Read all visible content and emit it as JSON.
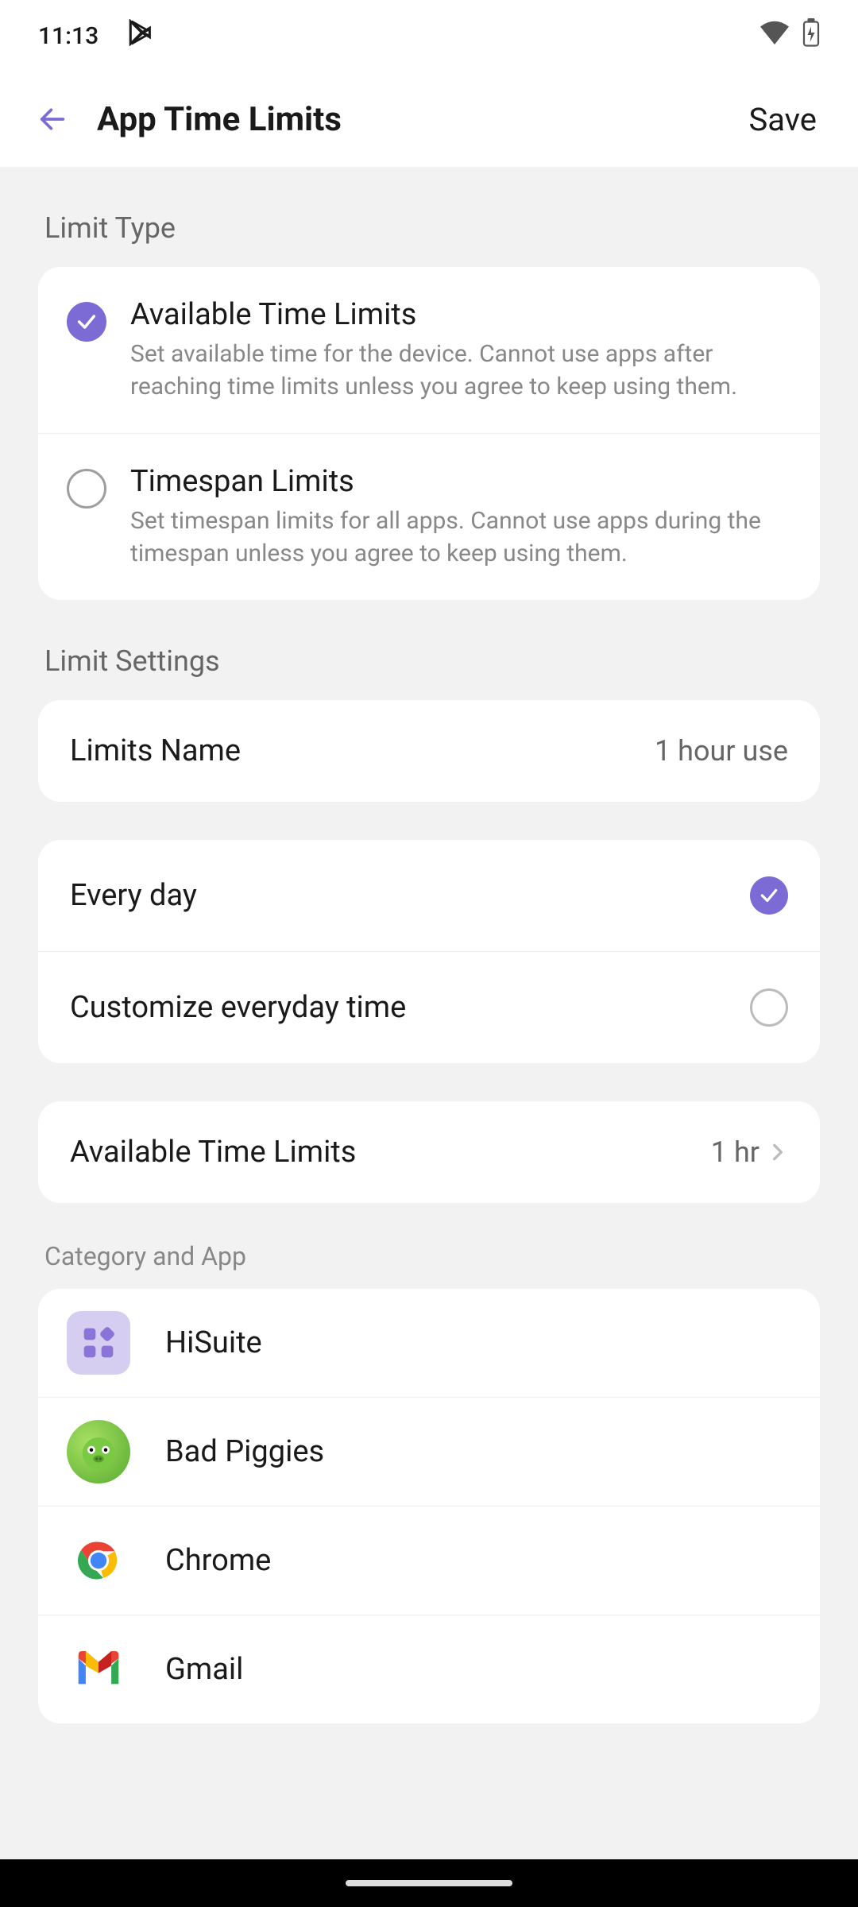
{
  "status": {
    "time": "11:13"
  },
  "header": {
    "title": "App Time Limits",
    "save": "Save"
  },
  "section_limit_type": "Limit Type",
  "limit_types": {
    "available": {
      "title": "Available Time Limits",
      "desc": "Set available time for the device. Cannot use apps after reaching time limits unless you agree to keep using them.",
      "selected": true
    },
    "timespan": {
      "title": "Timespan Limits",
      "desc": "Set timespan limits for all apps. Cannot use apps during the timespan unless you agree to keep using them.",
      "selected": false
    }
  },
  "section_limit_settings": "Limit Settings",
  "limits_name": {
    "label": "Limits Name",
    "value": "1 hour use"
  },
  "frequency": {
    "every_day": {
      "label": "Every day",
      "selected": true
    },
    "customize": {
      "label": "Customize everyday time",
      "selected": false
    }
  },
  "available_limit": {
    "label": "Available Time Limits",
    "value": "1 hr"
  },
  "category_label": "Category and App",
  "apps": {
    "hisuite": "HiSuite",
    "badpiggies": "Bad Piggies",
    "chrome": "Chrome",
    "gmail": "Gmail"
  },
  "colors": {
    "accent": "#7c6bd4"
  }
}
